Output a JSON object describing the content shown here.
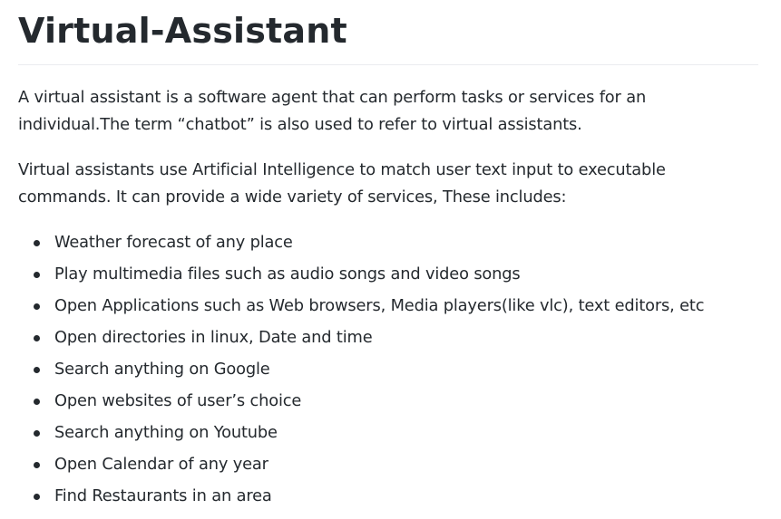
{
  "title": "Virtual-Assistant",
  "paragraphs": [
    "A virtual assistant is a software agent that can perform tasks or services for an individual.The term “chatbot” is also used to refer to virtual assistants.",
    "Virtual assistants use Artificial Intelligence to match user text input to executable commands. It can provide a wide variety of services, These includes:"
  ],
  "features": [
    "Weather forecast of any place",
    "Play multimedia files such as audio songs and video songs",
    "Open Applications such as Web browsers, Media players(like vlc), text editors, etc",
    "Open directories in linux, Date and time",
    "Search anything on Google",
    "Open websites of user’s choice",
    "Search anything on Youtube",
    "Open Calendar of any year",
    "Find Restaurants in an area"
  ]
}
